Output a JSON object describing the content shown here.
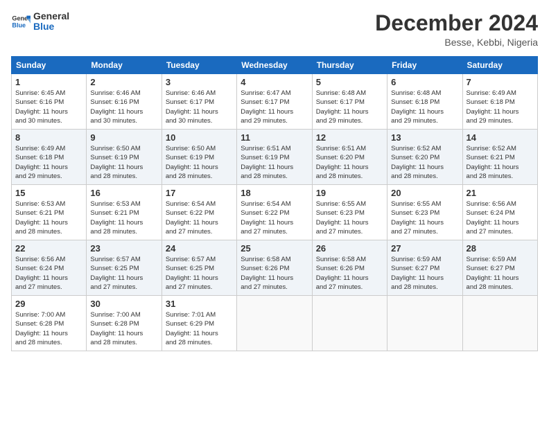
{
  "logo": {
    "line1": "General",
    "line2": "Blue"
  },
  "title": "December 2024",
  "location": "Besse, Kebbi, Nigeria",
  "days_header": [
    "Sunday",
    "Monday",
    "Tuesday",
    "Wednesday",
    "Thursday",
    "Friday",
    "Saturday"
  ],
  "weeks": [
    [
      {
        "day": "1",
        "detail": "Sunrise: 6:45 AM\nSunset: 6:16 PM\nDaylight: 11 hours\nand 30 minutes."
      },
      {
        "day": "2",
        "detail": "Sunrise: 6:46 AM\nSunset: 6:16 PM\nDaylight: 11 hours\nand 30 minutes."
      },
      {
        "day": "3",
        "detail": "Sunrise: 6:46 AM\nSunset: 6:17 PM\nDaylight: 11 hours\nand 30 minutes."
      },
      {
        "day": "4",
        "detail": "Sunrise: 6:47 AM\nSunset: 6:17 PM\nDaylight: 11 hours\nand 29 minutes."
      },
      {
        "day": "5",
        "detail": "Sunrise: 6:48 AM\nSunset: 6:17 PM\nDaylight: 11 hours\nand 29 minutes."
      },
      {
        "day": "6",
        "detail": "Sunrise: 6:48 AM\nSunset: 6:18 PM\nDaylight: 11 hours\nand 29 minutes."
      },
      {
        "day": "7",
        "detail": "Sunrise: 6:49 AM\nSunset: 6:18 PM\nDaylight: 11 hours\nand 29 minutes."
      }
    ],
    [
      {
        "day": "8",
        "detail": "Sunrise: 6:49 AM\nSunset: 6:18 PM\nDaylight: 11 hours\nand 29 minutes."
      },
      {
        "day": "9",
        "detail": "Sunrise: 6:50 AM\nSunset: 6:19 PM\nDaylight: 11 hours\nand 28 minutes."
      },
      {
        "day": "10",
        "detail": "Sunrise: 6:50 AM\nSunset: 6:19 PM\nDaylight: 11 hours\nand 28 minutes."
      },
      {
        "day": "11",
        "detail": "Sunrise: 6:51 AM\nSunset: 6:19 PM\nDaylight: 11 hours\nand 28 minutes."
      },
      {
        "day": "12",
        "detail": "Sunrise: 6:51 AM\nSunset: 6:20 PM\nDaylight: 11 hours\nand 28 minutes."
      },
      {
        "day": "13",
        "detail": "Sunrise: 6:52 AM\nSunset: 6:20 PM\nDaylight: 11 hours\nand 28 minutes."
      },
      {
        "day": "14",
        "detail": "Sunrise: 6:52 AM\nSunset: 6:21 PM\nDaylight: 11 hours\nand 28 minutes."
      }
    ],
    [
      {
        "day": "15",
        "detail": "Sunrise: 6:53 AM\nSunset: 6:21 PM\nDaylight: 11 hours\nand 28 minutes."
      },
      {
        "day": "16",
        "detail": "Sunrise: 6:53 AM\nSunset: 6:21 PM\nDaylight: 11 hours\nand 28 minutes."
      },
      {
        "day": "17",
        "detail": "Sunrise: 6:54 AM\nSunset: 6:22 PM\nDaylight: 11 hours\nand 27 minutes."
      },
      {
        "day": "18",
        "detail": "Sunrise: 6:54 AM\nSunset: 6:22 PM\nDaylight: 11 hours\nand 27 minutes."
      },
      {
        "day": "19",
        "detail": "Sunrise: 6:55 AM\nSunset: 6:23 PM\nDaylight: 11 hours\nand 27 minutes."
      },
      {
        "day": "20",
        "detail": "Sunrise: 6:55 AM\nSunset: 6:23 PM\nDaylight: 11 hours\nand 27 minutes."
      },
      {
        "day": "21",
        "detail": "Sunrise: 6:56 AM\nSunset: 6:24 PM\nDaylight: 11 hours\nand 27 minutes."
      }
    ],
    [
      {
        "day": "22",
        "detail": "Sunrise: 6:56 AM\nSunset: 6:24 PM\nDaylight: 11 hours\nand 27 minutes."
      },
      {
        "day": "23",
        "detail": "Sunrise: 6:57 AM\nSunset: 6:25 PM\nDaylight: 11 hours\nand 27 minutes."
      },
      {
        "day": "24",
        "detail": "Sunrise: 6:57 AM\nSunset: 6:25 PM\nDaylight: 11 hours\nand 27 minutes."
      },
      {
        "day": "25",
        "detail": "Sunrise: 6:58 AM\nSunset: 6:26 PM\nDaylight: 11 hours\nand 27 minutes."
      },
      {
        "day": "26",
        "detail": "Sunrise: 6:58 AM\nSunset: 6:26 PM\nDaylight: 11 hours\nand 27 minutes."
      },
      {
        "day": "27",
        "detail": "Sunrise: 6:59 AM\nSunset: 6:27 PM\nDaylight: 11 hours\nand 28 minutes."
      },
      {
        "day": "28",
        "detail": "Sunrise: 6:59 AM\nSunset: 6:27 PM\nDaylight: 11 hours\nand 28 minutes."
      }
    ],
    [
      {
        "day": "29",
        "detail": "Sunrise: 7:00 AM\nSunset: 6:28 PM\nDaylight: 11 hours\nand 28 minutes."
      },
      {
        "day": "30",
        "detail": "Sunrise: 7:00 AM\nSunset: 6:28 PM\nDaylight: 11 hours\nand 28 minutes."
      },
      {
        "day": "31",
        "detail": "Sunrise: 7:01 AM\nSunset: 6:29 PM\nDaylight: 11 hours\nand 28 minutes."
      },
      {
        "day": "",
        "detail": ""
      },
      {
        "day": "",
        "detail": ""
      },
      {
        "day": "",
        "detail": ""
      },
      {
        "day": "",
        "detail": ""
      }
    ]
  ]
}
